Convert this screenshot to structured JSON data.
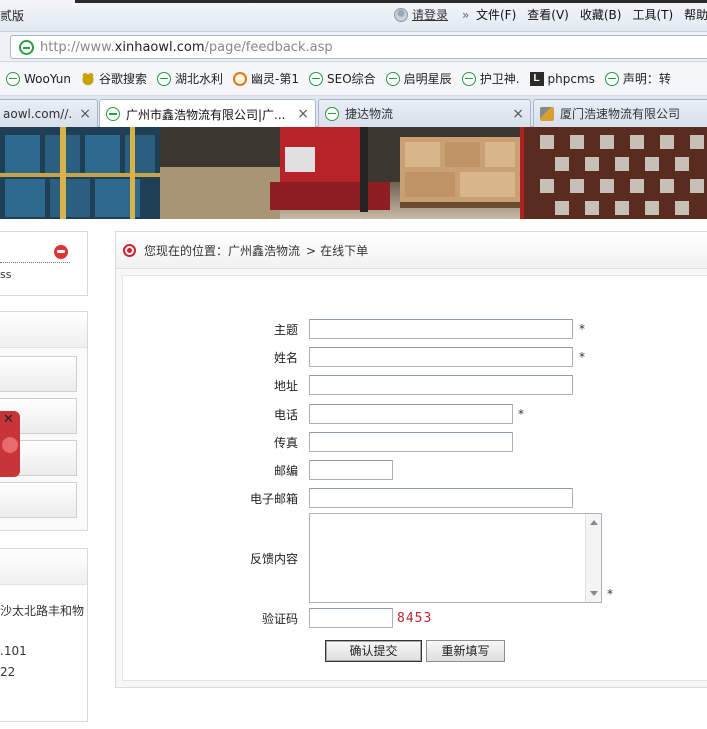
{
  "browser": {
    "edge_text": "贰版",
    "user_link": "请登录",
    "more_chevron": "»",
    "menu": [
      "文件(F)",
      "查看(V)",
      "收藏(B)",
      "工具(T)",
      "帮助("
    ],
    "url_prefix": "http://www.",
    "url_domain": "xinhaowl.com",
    "url_path": "/page/feedback.asp",
    "favorites": [
      {
        "label": "WooYun",
        "icon": "page-icon"
      },
      {
        "label": "谷歌搜索",
        "icon": "dog-icon"
      },
      {
        "label": "湖北水利",
        "icon": "page-icon"
      },
      {
        "label": "幽灵-第1",
        "icon": "face-icon"
      },
      {
        "label": "SEO综合",
        "icon": "page-icon"
      },
      {
        "label": "启明星辰",
        "icon": "page-icon"
      },
      {
        "label": "护卫神.",
        "icon": "page-icon"
      },
      {
        "label": "phpcms",
        "icon": "L-icon"
      },
      {
        "label": "声明：转",
        "icon": "page-icon"
      }
    ],
    "tabs": [
      {
        "label": "aowl.com//...",
        "close": "×"
      },
      {
        "label": "广州市鑫浩物流有限公司|广...",
        "close": "×"
      },
      {
        "label": "捷达物流",
        "close": "×"
      },
      {
        "label": "厦门浩速物流有限公司",
        "close": ""
      }
    ]
  },
  "sidebar": {
    "partial_text": "ss",
    "contact_lines": [
      "沙太北路丰和物",
      ".101",
      "22"
    ],
    "close_glyph": "✕"
  },
  "main": {
    "breadcrumb_prefix": "您现在的位置：",
    "breadcrumb_home": "广州鑫浩物流",
    "breadcrumb_sep": ">",
    "breadcrumb_current": "在线下单"
  },
  "form": {
    "subject_label": "主题",
    "subject_value": "",
    "name_label": "姓名",
    "name_value": "",
    "address_label": "地址",
    "address_value": "",
    "phone_label": "电话",
    "phone_value": "",
    "fax_label": "传真",
    "fax_value": "",
    "zip_label": "邮编",
    "zip_value": "",
    "email_label": "电子邮箱",
    "email_value": "",
    "content_label": "反馈内容",
    "captcha_label": "验证码",
    "captcha_value": "",
    "captcha_code": "8453",
    "required_mark": "*",
    "submit_label": "确认提交",
    "reset_label": "重新填写"
  },
  "colors": {
    "captcha_red": "#c1272d",
    "crumb_icon_red": "#cc2233"
  }
}
